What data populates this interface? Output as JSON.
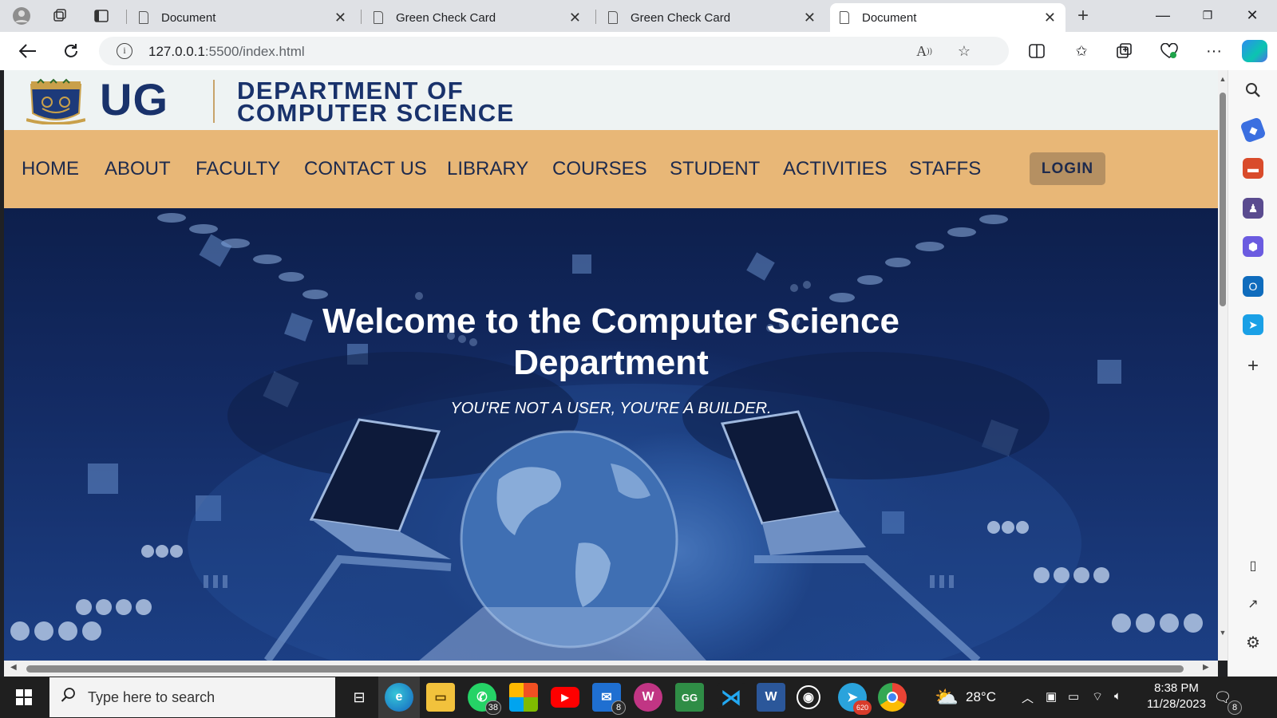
{
  "browser": {
    "tabs": [
      {
        "title": "Document",
        "active": false
      },
      {
        "title": "Green Check Card",
        "active": false
      },
      {
        "title": "Green Check Card",
        "active": false
      },
      {
        "title": "Document",
        "active": true
      }
    ],
    "new_tab_icon": "plus-icon",
    "url_host": "127.0.0.1",
    "url_rest": ":5500/index.html"
  },
  "site": {
    "logo_text": "UG",
    "dept_line1": "DEPARTMENT OF",
    "dept_line2": "COMPUTER SCIENCE",
    "menu": [
      "HOME",
      "ABOUT",
      "FACULTY",
      "CONTACT US",
      "LIBRARY",
      "COURSES",
      "STUDENT",
      "ACTIVITIES",
      "STAFFS"
    ],
    "login_label": "LOGIN",
    "hero_title_line1": "Welcome to the Computer Science",
    "hero_title_line2": "Department",
    "hero_subtitle": "YOU'RE NOT A USER, YOU'RE A BUILDER."
  },
  "taskbar": {
    "search_placeholder": "Type here to search",
    "whatsapp_badge": "38",
    "mail_badge": "8",
    "telegram_badge": "620",
    "weather_temp": "28°C",
    "time": "8:38 PM",
    "date": "11/28/2023",
    "notification_count": "8"
  },
  "colors": {
    "menu_bar": "#e8b777",
    "navy_text": "#19326b",
    "login_button": "#b59062",
    "hero_dark": "#0d1f4c"
  }
}
